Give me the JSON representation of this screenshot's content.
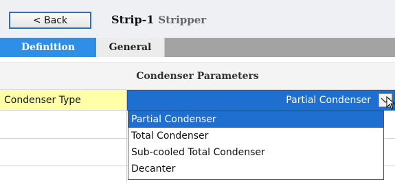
{
  "header": {
    "back_label": "< Back",
    "block_id": "Strip-1",
    "block_type": "Stripper"
  },
  "tabs": [
    {
      "label": "Definition",
      "active": true
    },
    {
      "label": "General",
      "active": false
    }
  ],
  "section": {
    "title": "Condenser Parameters"
  },
  "condenser": {
    "label": "Condenser Type",
    "selected_value": "Partial Condenser",
    "options": [
      "Partial Condenser",
      "Total Condenser",
      "Sub-cooled Total Condenser",
      "Decanter"
    ]
  },
  "colors": {
    "accent_blue": "#1e6fd0",
    "tab_active": "#2f8ee6",
    "label_yellow": "#ffffa8"
  }
}
